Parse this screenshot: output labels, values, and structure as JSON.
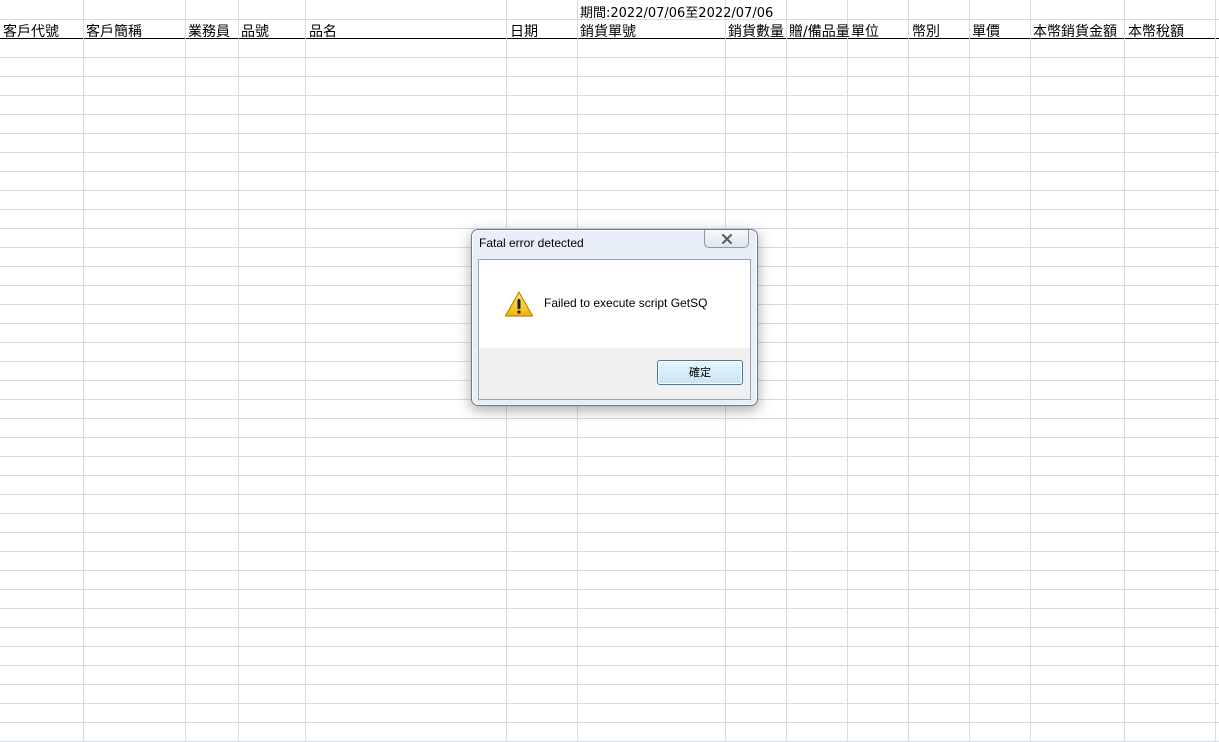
{
  "sheet": {
    "period": "期間:2022/07/06至2022/07/06",
    "headers": [
      "客戶代號",
      "客戶簡稱",
      "業務員",
      "品號",
      "品名",
      "日期",
      "銷貨單號",
      "銷貨數量",
      "贈/備品量",
      "單位",
      "幣別",
      "單價",
      "本幣銷貨金額",
      "本幣稅額"
    ]
  },
  "dialog": {
    "title": "Fatal error detected",
    "message": "Failed to execute script GetSQ",
    "ok_label": "確定",
    "icon": "warning-icon",
    "close_icon": "close-icon"
  },
  "colors": {
    "gridline": "#d4dae6",
    "dialog_frame": "#e8eef7",
    "button_area": "#f0f0f0",
    "ok_button_border": "#3c7fb1"
  }
}
